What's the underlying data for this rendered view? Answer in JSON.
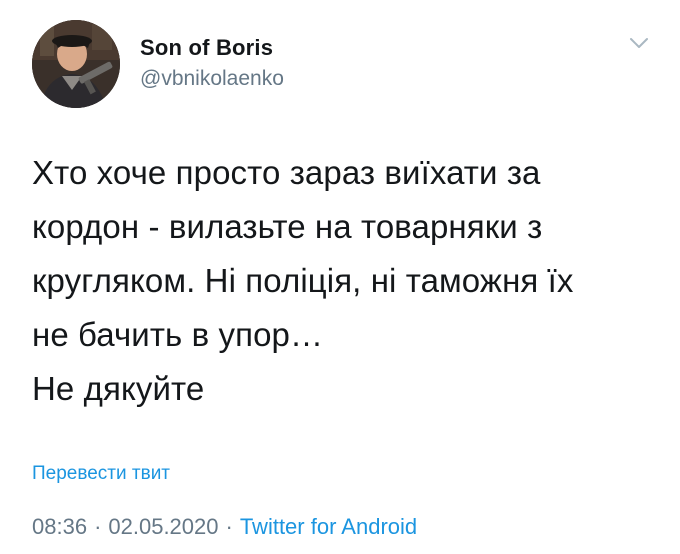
{
  "user": {
    "display_name": "Son of Boris",
    "handle": "@vbnikolaenko"
  },
  "tweet": {
    "text": "Хто хоче просто зараз виїхати за\nкордон - вилазьте на товарняки з\nкругляком. Ні поліція, ні таможня їх\nне бачить в упор…\nНе дякуйте",
    "translate_label": "Перевести твит",
    "time": "08:36",
    "date": "02.05.2020",
    "separator": "·",
    "source": "Twitter for Android"
  },
  "icons": {
    "more": "chevron-down-icon",
    "avatar": "avatar"
  },
  "colors": {
    "text": "#14171a",
    "secondary": "#657786",
    "link": "#1b95e0"
  }
}
